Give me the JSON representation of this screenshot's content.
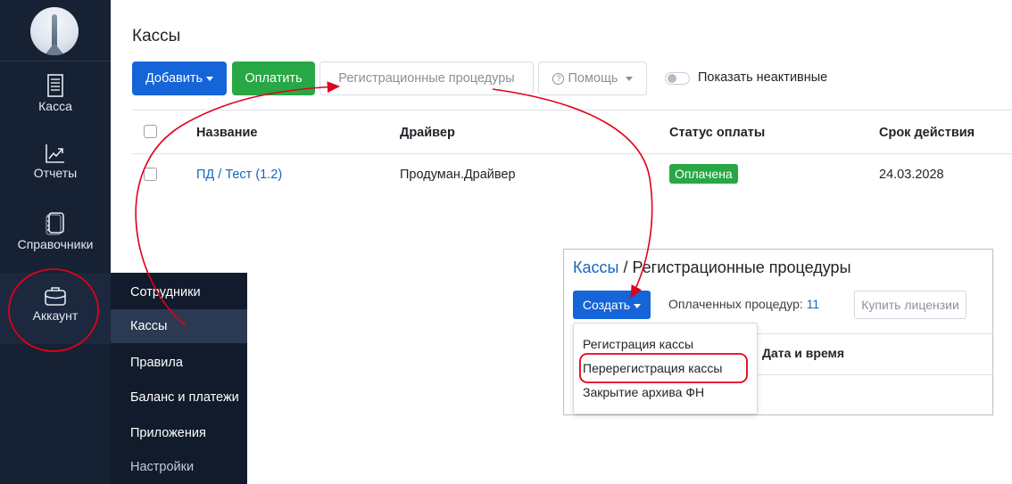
{
  "sidebar": {
    "items": [
      {
        "label": "Касса",
        "icon": "receipt-icon"
      },
      {
        "label": "Отчеты",
        "icon": "chart-icon"
      },
      {
        "label": "Справочники",
        "icon": "book-icon"
      },
      {
        "label": "Аккаунт",
        "icon": "briefcase-icon"
      }
    ]
  },
  "submenu": {
    "items": [
      {
        "label": "Сотрудники"
      },
      {
        "label": "Кассы"
      },
      {
        "label": "Правила"
      },
      {
        "label": "Баланс и платежи"
      },
      {
        "label": "Приложения"
      },
      {
        "label": "Настройки"
      }
    ]
  },
  "page": {
    "title": "Кассы",
    "toolbar": {
      "add_label": "Добавить",
      "pay_label": "Оплатить",
      "reg_label": "Регистрационные процедуры",
      "help_label": "Помощь",
      "help_icon": "?",
      "toggle_label": "Показать неактивные"
    },
    "table": {
      "headers": [
        "Название",
        "Драйвер",
        "Статус оплаты",
        "Срок действия"
      ],
      "rows": [
        {
          "name": "ПД / Тест (1.2)",
          "driver": "Продуман.Драйвер",
          "status": "Оплачена",
          "expires": "24.03.2028"
        }
      ]
    }
  },
  "inset": {
    "crumb_link": "Кассы",
    "crumb_sep": " / ",
    "crumb_current": "Регистрационные процедуры",
    "create_label": "Создать",
    "paid_label": "Оплаченных процедур: ",
    "paid_count": "11",
    "buy_label": "Купить лицензии",
    "column": "Дата и время",
    "dropdown": [
      {
        "label": "Регистрация кассы"
      },
      {
        "label": "Перерегистрация кассы"
      },
      {
        "label": "Закрытие архива ФН"
      }
    ]
  },
  "colors": {
    "sidebar_bg": "#162133",
    "primary": "#1565d8",
    "success": "#28a745",
    "annotation": "#e0001b"
  }
}
